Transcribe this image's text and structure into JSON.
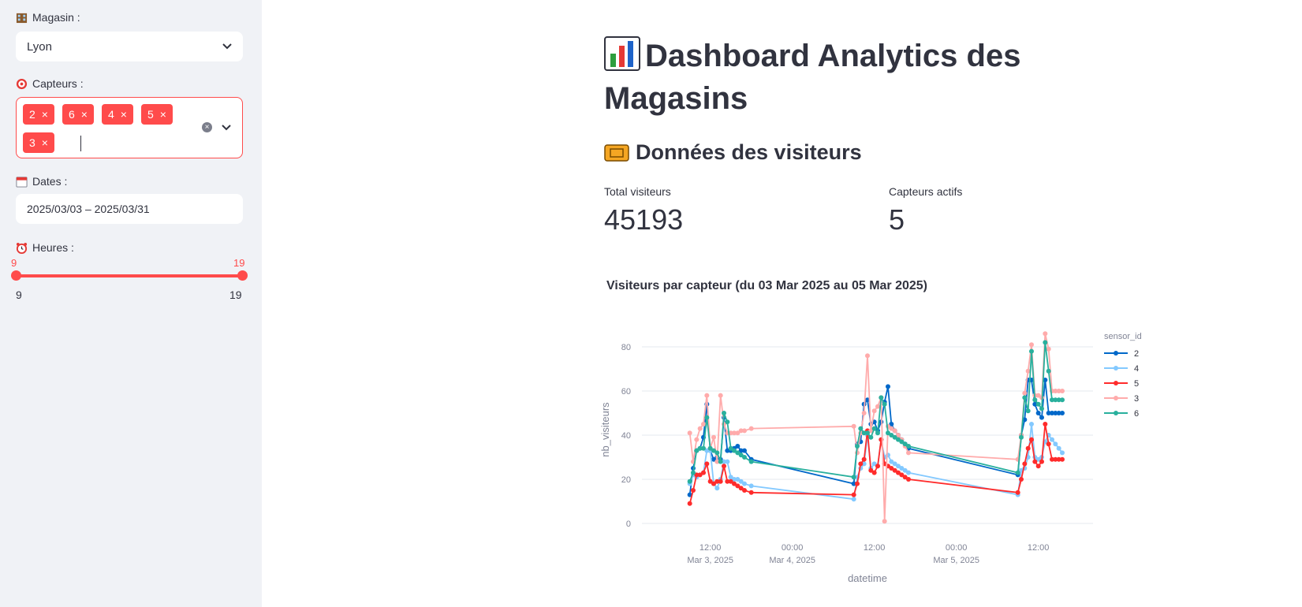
{
  "sidebar": {
    "magasin": {
      "label": "Magasin :",
      "value": "Lyon"
    },
    "capteurs": {
      "label": "Capteurs :",
      "tags": [
        "2",
        "6",
        "4",
        "5",
        "3"
      ],
      "tag_close": "×"
    },
    "dates": {
      "label": "Dates :",
      "value": "2025/03/03 – 2025/03/31"
    },
    "heures": {
      "label": "Heures :",
      "low": "9",
      "high": "19",
      "min": "9",
      "max": "19"
    }
  },
  "main": {
    "title": "Dashboard Analytics des Magasins",
    "section_title": "Données des visiteurs",
    "metrics": [
      {
        "label": "Total visiteurs",
        "value": "45193"
      },
      {
        "label": "Capteurs actifs",
        "value": "5"
      }
    ]
  },
  "colors": {
    "accent": "#ff4b4b",
    "s2": "#0068c9",
    "s4": "#83c9ff",
    "s5": "#ff2b2b",
    "s3": "#ffabab",
    "s6": "#29b09d"
  },
  "chart_data": {
    "type": "line",
    "title": "Visiteurs par capteur (du 03 Mar 2025 au 05 Mar 2025)",
    "xlabel": "datetime",
    "ylabel": "nb_visiteurs",
    "legend_title": "sensor_id",
    "ylim": [
      0,
      85
    ],
    "yticks": [
      0,
      20,
      40,
      60,
      80
    ],
    "xticks": [
      {
        "t": 12,
        "label": "12:00",
        "sub": "Mar 3, 2025"
      },
      {
        "t": 24,
        "label": "00:00",
        "sub": "Mar 4, 2025"
      },
      {
        "t": 36,
        "label": "12:00",
        "sub": ""
      },
      {
        "t": 48,
        "label": "00:00",
        "sub": "Mar 5, 2025"
      },
      {
        "t": 60,
        "label": "12:00",
        "sub": ""
      }
    ],
    "x": [
      9,
      9.5,
      10,
      10.5,
      11,
      11.5,
      12,
      12.5,
      13,
      13.5,
      14,
      14.5,
      15,
      15.5,
      16,
      16.5,
      17,
      18,
      33,
      33.5,
      34,
      34.5,
      35,
      35.5,
      36,
      36.5,
      37,
      37.5,
      38,
      38.5,
      39,
      39.5,
      40,
      40.5,
      41,
      57,
      57.5,
      58,
      58.5,
      59,
      59.5,
      60,
      60.5,
      61,
      61.5,
      62,
      62.5,
      63,
      63.5
    ],
    "series": [
      {
        "name": "2",
        "color": "#0068c9",
        "values": [
          13,
          25,
          33,
          34,
          39,
          54,
          33,
          29,
          30,
          29,
          48,
          33,
          33,
          34,
          35,
          33,
          33,
          29,
          18,
          36,
          37,
          54,
          56,
          45,
          46,
          42,
          46,
          55,
          62,
          45,
          42,
          40,
          38,
          36,
          34,
          22,
          40,
          47,
          65,
          65,
          54,
          50,
          48,
          65,
          50,
          50,
          50,
          50,
          50
        ]
      },
      {
        "name": "4",
        "color": "#83c9ff",
        "values": [
          18,
          22,
          21,
          22,
          23,
          33,
          33,
          18,
          16,
          20,
          28,
          28,
          21,
          20,
          20,
          19,
          18,
          17,
          11,
          21,
          25,
          27,
          40,
          25,
          27,
          26,
          38,
          30,
          31,
          28,
          27,
          26,
          25,
          24,
          23,
          13,
          24,
          25,
          30,
          45,
          30,
          29,
          30,
          37,
          40,
          38,
          36,
          34,
          32
        ]
      },
      {
        "name": "5",
        "color": "#ff2b2b",
        "values": [
          9,
          15,
          22,
          22,
          23,
          27,
          19,
          18,
          19,
          19,
          26,
          19,
          19,
          18,
          17,
          16,
          15,
          14,
          13,
          18,
          27,
          29,
          42,
          24,
          23,
          26,
          38,
          27,
          26,
          25,
          24,
          23,
          22,
          21,
          20,
          14,
          20,
          27,
          34,
          38,
          28,
          26,
          28,
          45,
          36,
          29,
          29,
          29,
          29
        ]
      },
      {
        "name": "3",
        "color": "#ffabab",
        "values": [
          41,
          28,
          38,
          43,
          45,
          58,
          34,
          39,
          28,
          58,
          45,
          41,
          41,
          41,
          41,
          42,
          42,
          43,
          44,
          32,
          41,
          50,
          76,
          42,
          51,
          53,
          57,
          1,
          44,
          43,
          42,
          40,
          38,
          35,
          32,
          29,
          40,
          59,
          69,
          81,
          58,
          58,
          57,
          86,
          79,
          60,
          60,
          60,
          60
        ]
      },
      {
        "name": "6",
        "color": "#29b09d",
        "values": [
          19,
          23,
          33,
          34,
          34,
          48,
          34,
          33,
          32,
          28,
          50,
          46,
          34,
          33,
          32,
          31,
          30,
          28,
          21,
          35,
          43,
          41,
          41,
          39,
          43,
          41,
          57,
          54,
          41,
          40,
          39,
          38,
          37,
          36,
          35,
          23,
          39,
          57,
          51,
          78,
          56,
          54,
          52,
          82,
          69,
          56,
          56,
          56,
          56
        ]
      }
    ]
  }
}
